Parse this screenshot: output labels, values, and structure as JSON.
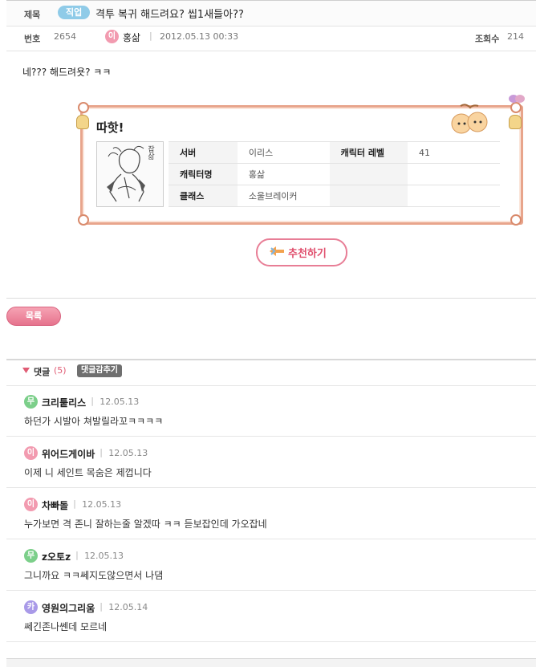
{
  "post": {
    "title_label": "제목",
    "category": "직업",
    "title": "격투 복귀 해드려요? 씹1새들아??",
    "number_label": "번호",
    "number": "2654",
    "author_icon": "이",
    "author": "홍삶",
    "date": "2012.05.13 00:33",
    "views_label": "조회수",
    "views": "214",
    "body": "네??? 해드려욧? ㅋㅋ"
  },
  "card": {
    "title": "따핫!",
    "avatar_caption": "잡삶",
    "rows": [
      {
        "label": "서버",
        "value": "이리스",
        "label2": "캐릭터 레벨",
        "value2": "41"
      },
      {
        "label": "캐릭터명",
        "value": "홍삶"
      },
      {
        "label": "클래스",
        "value": "소울브레이커"
      }
    ]
  },
  "recommend_label": "추천하기",
  "list_button": "목록",
  "comments_header": {
    "label": "댓글",
    "count": "(5)",
    "hide_button": "댓글감추기"
  },
  "comments": [
    {
      "icon": "무",
      "icon_color": "#7ccf8a",
      "author": "크리퉅리스",
      "date": "12.05.13",
      "text": "하던가 시발아 쳐발릴라꼬ㅋㅋㅋㅋ"
    },
    {
      "icon": "이",
      "icon_color": "#f29bb0",
      "author": "위어드게이바",
      "date": "12.05.13",
      "text": "이제 니 세인트 목숨은 제껍니다"
    },
    {
      "icon": "이",
      "icon_color": "#f29bb0",
      "author": "차빠돌",
      "date": "12.05.13",
      "text": "누가보면 격 존니 잘하는줄 알겠따 ㅋㅋ 듣보잡인데 가오잡네"
    },
    {
      "icon": "무",
      "icon_color": "#7ccf8a",
      "author": "z오토z",
      "date": "12.05.13",
      "text": "그니까요 ㅋㅋ쎄지도않으면서 나댐"
    },
    {
      "icon": "카",
      "icon_color": "#a99ae8",
      "author": "영원의그리움",
      "date": "12.05.14",
      "text": "쎄긴존나쎈데 모르네"
    }
  ]
}
